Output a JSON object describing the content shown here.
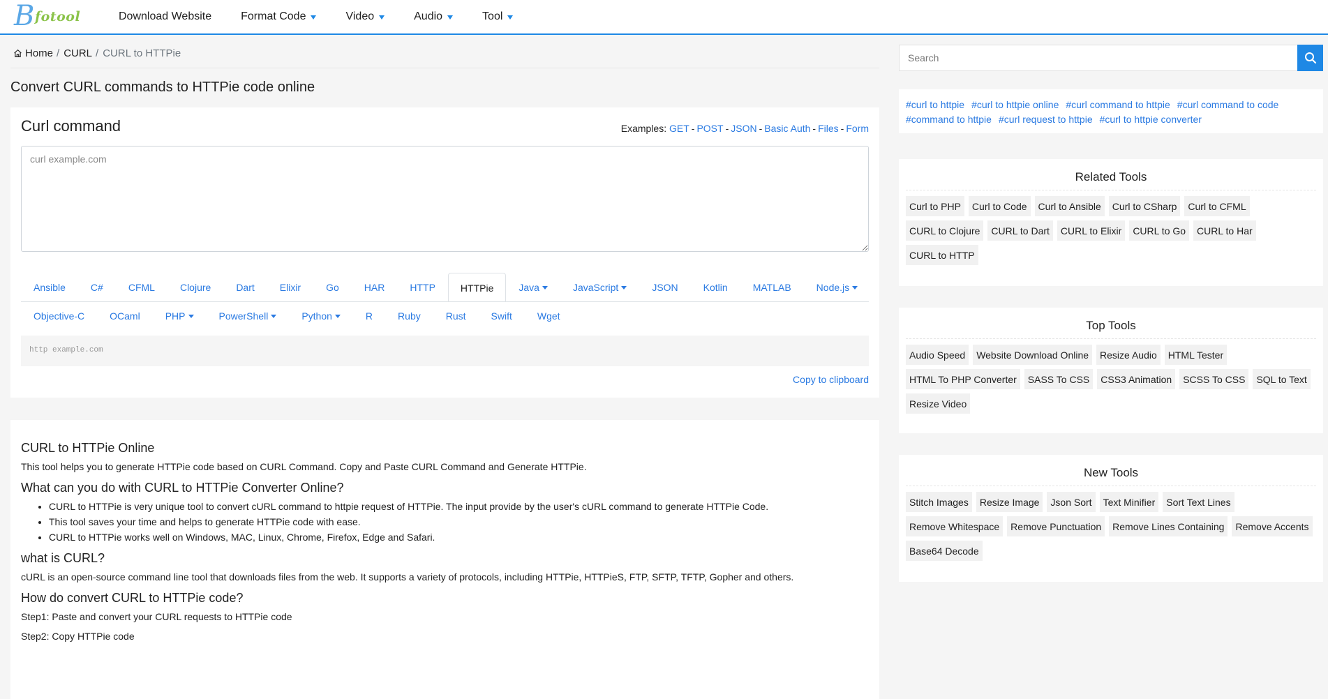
{
  "logo": {
    "mark": "B",
    "text": "fotool"
  },
  "nav": [
    {
      "label": "Download Website",
      "dropdown": false
    },
    {
      "label": "Format Code",
      "dropdown": true
    },
    {
      "label": "Video",
      "dropdown": true
    },
    {
      "label": "Audio",
      "dropdown": true
    },
    {
      "label": "Tool",
      "dropdown": true
    }
  ],
  "breadcrumb": {
    "home": "Home",
    "sep": "/",
    "parent": "CURL",
    "current": "CURL to HTTPie"
  },
  "page_title": "Convert CURL commands to HTTPie code online",
  "tool": {
    "title": "Curl command",
    "examples_label": "Examples:",
    "examples": [
      "GET",
      "POST",
      "JSON",
      "Basic Auth",
      "Files",
      "Form"
    ],
    "examples_dash": "-",
    "input_placeholder": "curl example.com",
    "tabs_row1": [
      {
        "label": "Ansible",
        "dropdown": false,
        "active": false
      },
      {
        "label": "C#",
        "dropdown": false,
        "active": false
      },
      {
        "label": "CFML",
        "dropdown": false,
        "active": false
      },
      {
        "label": "Clojure",
        "dropdown": false,
        "active": false
      },
      {
        "label": "Dart",
        "dropdown": false,
        "active": false
      },
      {
        "label": "Elixir",
        "dropdown": false,
        "active": false
      },
      {
        "label": "Go",
        "dropdown": false,
        "active": false
      },
      {
        "label": "HAR",
        "dropdown": false,
        "active": false
      },
      {
        "label": "HTTP",
        "dropdown": false,
        "active": false
      },
      {
        "label": "HTTPie",
        "dropdown": false,
        "active": true
      },
      {
        "label": "Java",
        "dropdown": true,
        "active": false
      },
      {
        "label": "JavaScript",
        "dropdown": true,
        "active": false
      },
      {
        "label": "JSON",
        "dropdown": false,
        "active": false
      },
      {
        "label": "Kotlin",
        "dropdown": false,
        "active": false
      },
      {
        "label": "MATLAB",
        "dropdown": false,
        "active": false
      },
      {
        "label": "Node.js",
        "dropdown": true,
        "active": false
      }
    ],
    "tabs_row2": [
      {
        "label": "Objective-C",
        "dropdown": false,
        "active": false
      },
      {
        "label": "OCaml",
        "dropdown": false,
        "active": false
      },
      {
        "label": "PHP",
        "dropdown": true,
        "active": false
      },
      {
        "label": "PowerShell",
        "dropdown": true,
        "active": false
      },
      {
        "label": "Python",
        "dropdown": true,
        "active": false
      },
      {
        "label": "R",
        "dropdown": false,
        "active": false
      },
      {
        "label": "Ruby",
        "dropdown": false,
        "active": false
      },
      {
        "label": "Rust",
        "dropdown": false,
        "active": false
      },
      {
        "label": "Swift",
        "dropdown": false,
        "active": false
      },
      {
        "label": "Wget",
        "dropdown": false,
        "active": false
      }
    ],
    "output_text": "http example.com",
    "copy_label": "Copy to clipboard"
  },
  "info": {
    "h1": "CURL to HTTPie Online",
    "p1": "This tool helps you to generate HTTPie code based on CURL Command. Copy and Paste CURL Command and Generate HTTPie.",
    "h2": "What can you do with CURL to HTTPie Converter Online?",
    "bullets": [
      "CURL to HTTPie is very unique tool to convert cURL command to httpie request of HTTPie. The input provide by the user's cURL command to generate HTTPie Code.",
      "This tool saves your time and helps to generate HTTPie code with ease.",
      "CURL to HTTPie works well on Windows, MAC, Linux, Chrome, Firefox, Edge and Safari."
    ],
    "h3": "what is CURL?",
    "p2": "cURL is an open-source command line tool that downloads files from the web. It supports a variety of protocols, including HTTPie, HTTPieS, FTP, SFTP, TFTP, Gopher and others.",
    "h4": "How do convert CURL to HTTPie code?",
    "step1": "Step1: Paste and convert your CURL requests to HTTPie code",
    "step2": "Step2: Copy HTTPie code"
  },
  "sidebar": {
    "search_placeholder": "Search",
    "tags": [
      "#curl to httpie",
      "#curl to httpie online",
      "#curl command to httpie",
      "#curl command to code",
      "#command to httpie",
      "#curl request to httpie",
      "#curl to httpie converter"
    ],
    "related": {
      "title": "Related Tools",
      "items": [
        "Curl to PHP",
        "Curl to Code",
        "Curl to Ansible",
        "Curl to CSharp",
        "Curl to CFML",
        "CURL to Clojure",
        "CURL to Dart",
        "CURL to Elixir",
        "CURL to Go",
        "CURL to Har",
        "CURL to HTTP"
      ]
    },
    "top": {
      "title": "Top Tools",
      "items": [
        "Audio Speed",
        "Website Download Online",
        "Resize Audio",
        "HTML Tester",
        "HTML To PHP Converter",
        "SASS To CSS",
        "CSS3 Animation",
        "SCSS To CSS",
        "SQL to Text",
        "Resize Video"
      ]
    },
    "new": {
      "title": "New Tools",
      "items": [
        "Stitch Images",
        "Resize Image",
        "Json Sort",
        "Text Minifier",
        "Sort Text Lines",
        "Remove Whitespace",
        "Remove Punctuation",
        "Remove Lines Containing",
        "Remove Accents",
        "Base64 Decode"
      ]
    }
  },
  "colors": {
    "accent": "#1e88e5",
    "link": "#2a7ae2",
    "logo_blue": "#5aa7e6",
    "logo_green": "#8bc34a"
  }
}
